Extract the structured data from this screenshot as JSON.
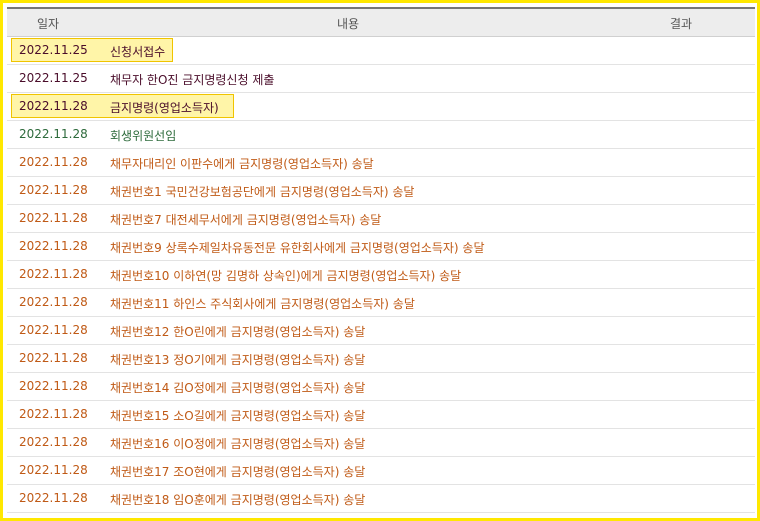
{
  "header": {
    "date": "일자",
    "content": "내용",
    "result": "결과"
  },
  "rows": [
    {
      "date": "2022.11.25",
      "content": "신청서접수",
      "result": ""
    },
    {
      "date": "2022.11.25",
      "content": "채무자 한O진 금지명령신청 제출",
      "result": ""
    },
    {
      "date": "2022.11.28",
      "content": "금지명령(영업소득자)",
      "result": ""
    },
    {
      "date": "2022.11.28",
      "content": "회생위원선임",
      "result": ""
    },
    {
      "date": "2022.11.28",
      "content": "채무자대리인 이판수에게 금지명령(영업소득자) 송달",
      "result": ""
    },
    {
      "date": "2022.11.28",
      "content": "채권번호1 국민건강보험공단에게 금지명령(영업소득자) 송달",
      "result": ""
    },
    {
      "date": "2022.11.28",
      "content": "채권번호7 대전세무서에게 금지명령(영업소득자) 송달",
      "result": ""
    },
    {
      "date": "2022.11.28",
      "content": "채권번호9 상록수제일차유동전문 유한회사에게 금지명령(영업소득자) 송달",
      "result": ""
    },
    {
      "date": "2022.11.28",
      "content": "채권번호10 이하연(망 김명하 상속인)에게 금지명령(영업소득자) 송달",
      "result": ""
    },
    {
      "date": "2022.11.28",
      "content": "채권번호11 하인스 주식회사에게 금지명령(영업소득자) 송달",
      "result": ""
    },
    {
      "date": "2022.11.28",
      "content": "채권번호12 한O린에게 금지명령(영업소득자) 송달",
      "result": ""
    },
    {
      "date": "2022.11.28",
      "content": "채권번호13 정O기에게 금지명령(영업소득자) 송달",
      "result": ""
    },
    {
      "date": "2022.11.28",
      "content": "채권번호14 김O정에게 금지명령(영업소득자) 송달",
      "result": ""
    },
    {
      "date": "2022.11.28",
      "content": "채권번호15 소O길에게 금지명령(영업소득자) 송달",
      "result": ""
    },
    {
      "date": "2022.11.28",
      "content": "채권번호16 이O정에게 금지명령(영업소득자) 송달",
      "result": ""
    },
    {
      "date": "2022.11.28",
      "content": "채권번호17 조O현에게 금지명령(영업소득자) 송달",
      "result": ""
    },
    {
      "date": "2022.11.28",
      "content": "채권번호18 임O훈에게 금지명령(영업소득자) 송달",
      "result": ""
    }
  ],
  "colors": {
    "frame_border": "#ffe800",
    "highlight": "#fff5a8",
    "text_dark": "#4a0d2a",
    "text_green": "#2e6b3c",
    "text_orange": "#c05a16"
  }
}
